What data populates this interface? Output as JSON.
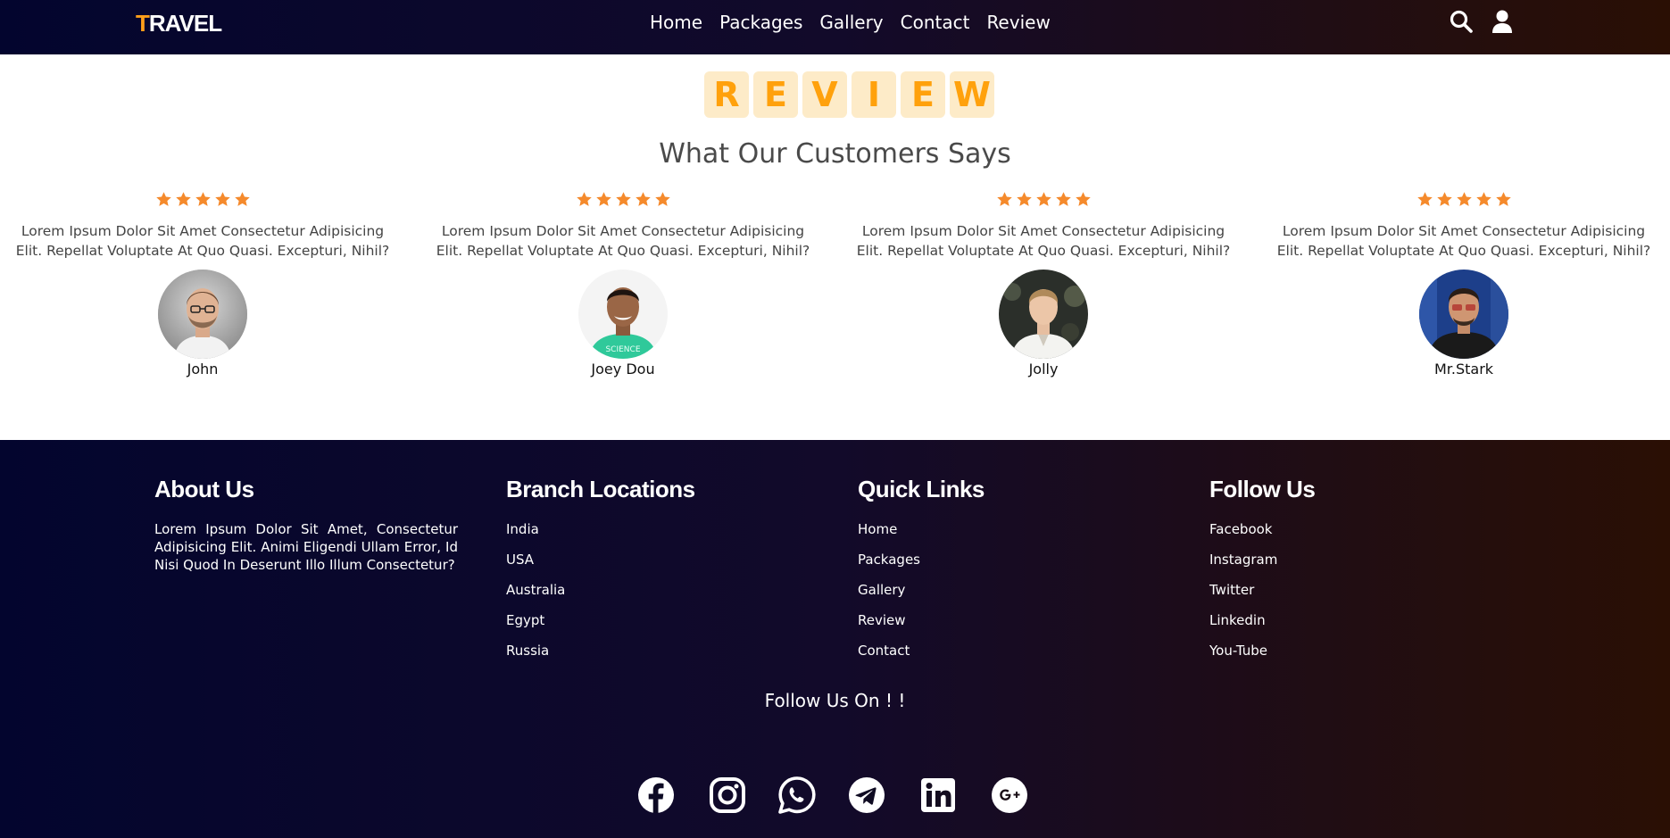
{
  "header": {
    "logo_first": "T",
    "logo_rest": "RAVEL",
    "nav": [
      "Home",
      "Packages",
      "Gallery",
      "Contact",
      "Review"
    ]
  },
  "review": {
    "heading_letters": [
      "R",
      "E",
      "V",
      "I",
      "E",
      "W"
    ],
    "subtitle": "What Our Customers Says",
    "testimonials": [
      {
        "rating": 5,
        "text": "Lorem Ipsum Dolor Sit Amet Consectetur Adipisicing Elit. Repellat Voluptate At Quo Quasi. Excepturi, Nihil?",
        "name": "John"
      },
      {
        "rating": 5,
        "text": "Lorem Ipsum Dolor Sit Amet Consectetur Adipisicing Elit. Repellat Voluptate At Quo Quasi. Excepturi, Nihil?",
        "name": "Joey Dou"
      },
      {
        "rating": 5,
        "text": "Lorem Ipsum Dolor Sit Amet Consectetur Adipisicing Elit. Repellat Voluptate At Quo Quasi. Excepturi, Nihil?",
        "name": "Jolly"
      },
      {
        "rating": 5,
        "text": "Lorem Ipsum Dolor Sit Amet Consectetur Adipisicing Elit. Repellat Voluptate At Quo Quasi. Excepturi, Nihil?",
        "name": "Mr.Stark"
      }
    ]
  },
  "footer": {
    "about": {
      "title": "About Us",
      "text": "Lorem Ipsum Dolor Sit Amet, Consectetur Adipisicing Elit. Animi Eligendi Ullam Error, Id Nisi Quod In Deserunt Illo Illum Consectetur?"
    },
    "branches": {
      "title": "Branch Locations",
      "items": [
        "India",
        "USA",
        "Australia",
        "Egypt",
        "Russia"
      ]
    },
    "quick_links": {
      "title": "Quick Links",
      "items": [
        "Home",
        "Packages",
        "Gallery",
        "Review",
        "Contact"
      ]
    },
    "follow": {
      "title": "Follow Us",
      "items": [
        "Facebook",
        "Instagram",
        "Twitter",
        "Linkedin",
        "You-Tube"
      ]
    },
    "follow_on": "Follow Us On ! !",
    "social_icons": [
      "facebook-icon",
      "instagram-icon",
      "whatsapp-icon",
      "telegram-icon",
      "linkedin-icon",
      "google-plus-icon"
    ]
  },
  "colors": {
    "accent": "#ff9f1a",
    "star": "#f58a2c",
    "header_left": "#03052e",
    "header_right": "#2a0f04"
  }
}
